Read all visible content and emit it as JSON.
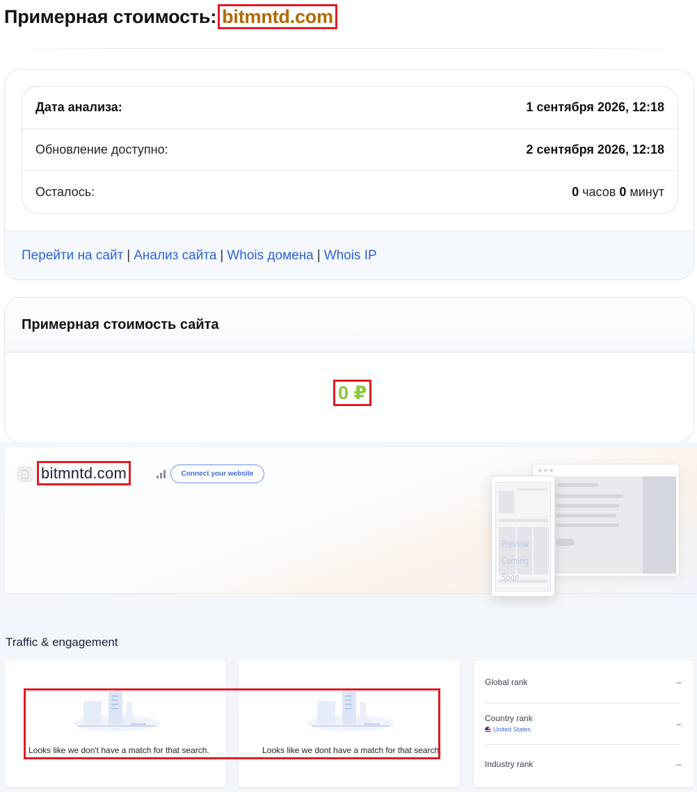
{
  "header": {
    "title_prefix": "Примерная стоимость:",
    "title_domain": "bitmntd.com"
  },
  "analysis": {
    "rows": [
      {
        "label": "Дата анализа:",
        "value": "1 сентября 2026, 12:18"
      },
      {
        "label": "Обновление доступно:",
        "value": "2 сентября 2026, 12:18"
      },
      {
        "label": "Осталось:",
        "hours": "0",
        "hours_unit": "часов",
        "minutes": "0",
        "minutes_unit": "минут"
      }
    ],
    "links": [
      "Перейти на сайт",
      "Анализ сайта",
      "Whois домена",
      "Whois IP"
    ],
    "separator": "|"
  },
  "estimate": {
    "title": "Примерная стоимость сайта",
    "price": "0 ₽"
  },
  "site_panel": {
    "domain": "bitmntd.com",
    "connect_label": "Connect your website",
    "preview_text_line1": "Preview",
    "preview_text_line2": "Coming Soon",
    "icons": {
      "favicon": "document-icon",
      "rank": "bar-chart-icon"
    }
  },
  "traffic": {
    "title": "Traffic & engagement",
    "no_match_1": "Looks like we don't have a match for that search.",
    "no_match_2": "Looks like we dont have a match for that search.",
    "ranks": [
      {
        "label": "Global rank",
        "value": "–"
      },
      {
        "label": "Country rank",
        "sub": "United States",
        "value": "–"
      },
      {
        "label": "Industry rank",
        "value": "–"
      }
    ]
  },
  "colors": {
    "highlight_border": "#e01b24",
    "domain_text": "#b06a00",
    "price_text": "#8cc63f",
    "link": "#2c63d9",
    "accent": "#3f6ad8"
  }
}
